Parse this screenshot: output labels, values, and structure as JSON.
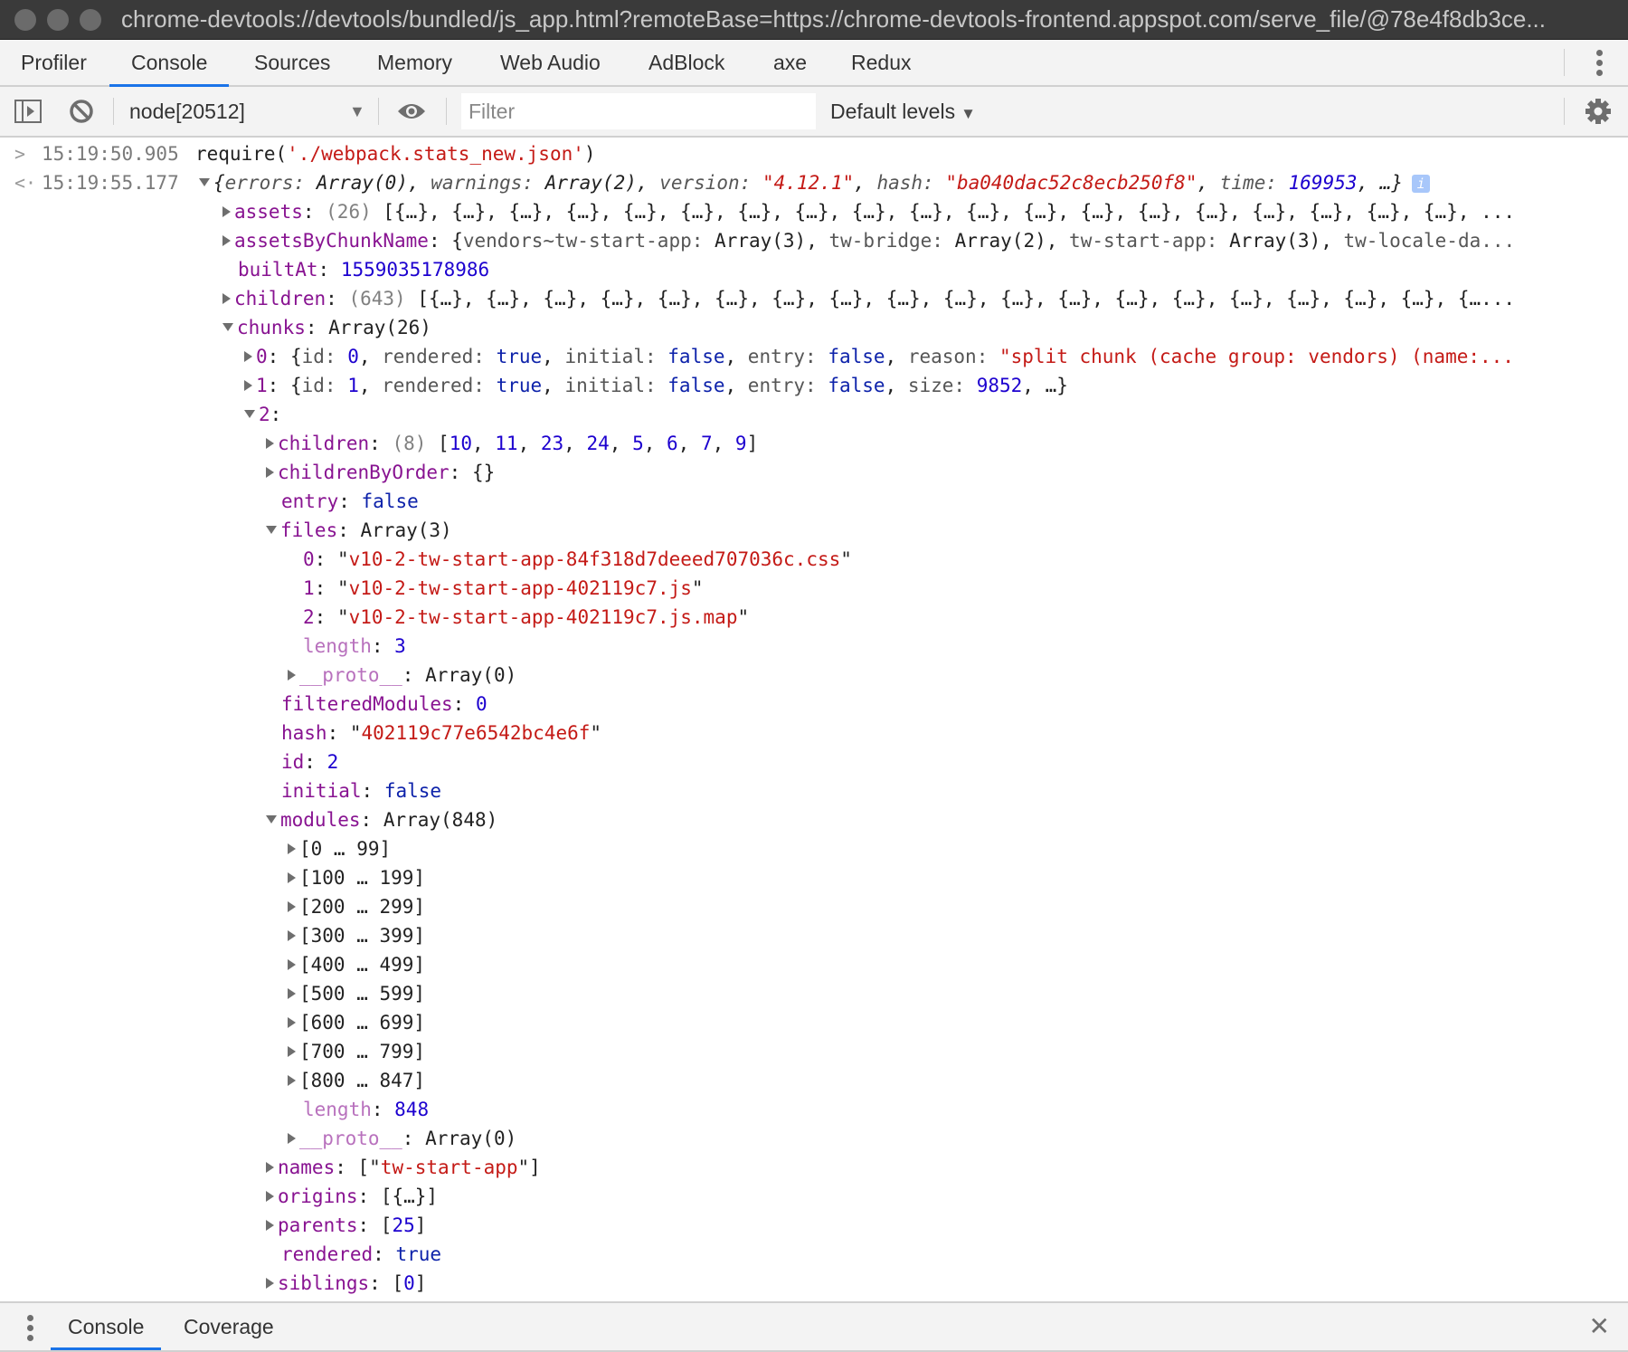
{
  "window": {
    "title": "chrome-devtools://devtools/bundled/js_app.html?remoteBase=https://chrome-devtools-frontend.appspot.com/serve_file/@78e4f8db3ce..."
  },
  "tabs": [
    {
      "label": "Profiler",
      "active": false
    },
    {
      "label": "Console",
      "active": true
    },
    {
      "label": "Sources",
      "active": false
    },
    {
      "label": "Memory",
      "active": false
    },
    {
      "label": "Web Audio",
      "active": false
    },
    {
      "label": "AdBlock",
      "active": false
    },
    {
      "label": "axe",
      "active": false
    },
    {
      "label": "Redux",
      "active": false
    }
  ],
  "toolbar": {
    "context": "node[20512]",
    "filter_placeholder": "Filter",
    "filter_value": "",
    "levels": "Default levels",
    "icons": [
      "sidebar-toggle-icon",
      "clear-console-icon",
      "eye-icon",
      "gear-icon"
    ]
  },
  "console": {
    "input": {
      "gutter": ">",
      "timestamp": "15:19:50.905",
      "command_prefix": "require(",
      "command_arg": "'./webpack.stats_new.json'",
      "command_suffix": ")"
    },
    "result": {
      "gutter": "<·",
      "timestamp": "15:19:55.177",
      "summary": {
        "errors_key": "errors",
        "errors_val": "Array(0)",
        "warnings_key": "warnings",
        "warnings_val": "Array(2)",
        "version_key": "version",
        "version_val": "\"4.12.1\"",
        "hash_key": "hash",
        "hash_val": "\"ba040dac52c8ecb250f8\"",
        "time_key": "time",
        "time_val": "169953",
        "tail": ", …}"
      },
      "assets": {
        "key": "assets",
        "count": "(26)",
        "preview": "[{…}, {…}, {…}, {…}, {…}, {…}, {…}, {…}, {…}, {…}, {…}, {…}, {…}, {…}, {…}, {…}, {…}, {…}, {…}, ..."
      },
      "assetsByChunkName": {
        "key": "assetsByChunkName",
        "k1": "vendors~tw-start-app",
        "v1": "Array(3)",
        "k2": "tw-bridge",
        "v2": "Array(2)",
        "k3": "tw-start-app",
        "v3": "Array(3)",
        "k4": "tw-locale-da..."
      },
      "builtAt": {
        "key": "builtAt",
        "value": "1559035178986"
      },
      "children": {
        "key": "children",
        "count": "(643)",
        "preview": "[{…}, {…}, {…}, {…}, {…}, {…}, {…}, {…}, {…}, {…}, {…}, {…}, {…}, {…}, {…}, {…}, {…}, {…}, {…..."
      },
      "chunks": {
        "key": "chunks",
        "value": "Array(26)",
        "item0": {
          "index": "0",
          "id": "0",
          "rendered": "true",
          "initial": "false",
          "entry": "false",
          "reason": "\"split chunk (cache group: vendors) (name:..."
        },
        "item1": {
          "index": "1",
          "id": "1",
          "rendered": "true",
          "initial": "false",
          "entry": "false",
          "size": "9852"
        },
        "item2": {
          "index": "2",
          "children": {
            "key": "children",
            "count": "(8)",
            "values": [
              "10",
              "11",
              "23",
              "24",
              "5",
              "6",
              "7",
              "9"
            ]
          },
          "childrenByOrder": {
            "key": "childrenByOrder",
            "value": "{}"
          },
          "entry": {
            "key": "entry",
            "value": "false"
          },
          "files": {
            "key": "files",
            "value": "Array(3)",
            "items": [
              {
                "index": "0",
                "value": "v10-2-tw-start-app-84f318d7deeed707036c.css"
              },
              {
                "index": "1",
                "value": "v10-2-tw-start-app-402119c7.js"
              },
              {
                "index": "2",
                "value": "v10-2-tw-start-app-402119c7.js.map"
              }
            ],
            "length": "3",
            "proto": "Array(0)"
          },
          "filteredModules": {
            "key": "filteredModules",
            "value": "0"
          },
          "hash": {
            "key": "hash",
            "value": "402119c77e6542bc4e6f"
          },
          "id": {
            "key": "id",
            "value": "2"
          },
          "initial": {
            "key": "initial",
            "value": "false"
          },
          "modules": {
            "key": "modules",
            "value": "Array(848)",
            "ranges": [
              "[0 … 99]",
              "[100 … 199]",
              "[200 … 299]",
              "[300 … 399]",
              "[400 … 499]",
              "[500 … 599]",
              "[600 … 699]",
              "[700 … 799]",
              "[800 … 847]"
            ],
            "length": "848",
            "proto": "Array(0)"
          },
          "names": {
            "key": "names",
            "value": "tw-start-app"
          },
          "origins": {
            "key": "origins",
            "value": "[{…}]"
          },
          "parents": {
            "key": "parents",
            "value": "25"
          },
          "rendered": {
            "key": "rendered",
            "value": "true"
          },
          "siblings": {
            "key": "siblings",
            "value": "0"
          }
        }
      }
    }
  },
  "drawer": {
    "tabs": [
      {
        "label": "Console",
        "active": true
      },
      {
        "label": "Coverage",
        "active": false
      }
    ]
  }
}
